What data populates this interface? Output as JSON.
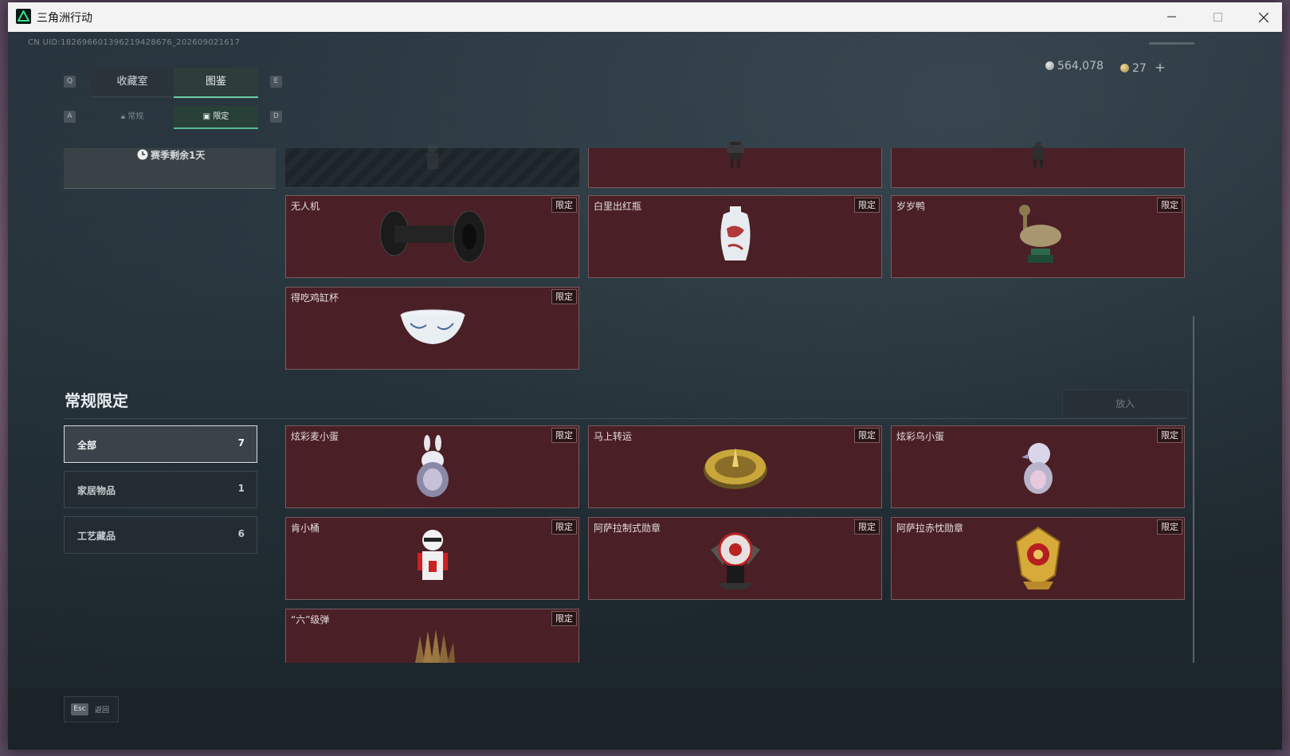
{
  "window": {
    "title": "三角洲行动"
  },
  "uid": "CN UID:182696601396219428676_202609021617",
  "currency": {
    "silver": "564,078",
    "gold": "27",
    "add": "+"
  },
  "tabs": {
    "key_left": "Q",
    "key_right": "E",
    "main": [
      {
        "label": "收藏室"
      },
      {
        "label": "图鉴"
      }
    ],
    "sub_key_left": "A",
    "sub_key_right": "D",
    "sub": [
      {
        "label": "常规"
      },
      {
        "label": "限定"
      }
    ]
  },
  "season": {
    "label": "赛季剩余1天"
  },
  "upper_cards": [
    {
      "name": "无人机",
      "badge": "限定"
    },
    {
      "name": "白里出红瓶",
      "badge": "限定"
    },
    {
      "name": "岁岁鸭",
      "badge": "限定"
    },
    {
      "name": "得吃鸡缸杯",
      "badge": "限定"
    }
  ],
  "section": {
    "title": "常规限定",
    "put_in": "放入"
  },
  "filters": [
    {
      "label": "全部",
      "count": "7"
    },
    {
      "label": "家居物品",
      "count": "1"
    },
    {
      "label": "工艺藏品",
      "count": "6"
    }
  ],
  "lower_cards": [
    {
      "name": "炫彩麦小蛋",
      "badge": "限定"
    },
    {
      "name": "马上转运",
      "badge": "限定"
    },
    {
      "name": "炫彩乌小蛋",
      "badge": "限定"
    },
    {
      "name": "肯小桶",
      "badge": "限定"
    },
    {
      "name": "阿萨拉制式勋章",
      "badge": "限定"
    },
    {
      "name": "阿萨拉赤忱勋章",
      "badge": "限定"
    },
    {
      "name": "“六”级弹",
      "badge": "限定"
    }
  ],
  "footer": {
    "key": "Esc",
    "label": "返回"
  },
  "colors": {
    "accent": "#6bd1a4",
    "card_bg": "#4a1f25",
    "card_border": "#7a5a5e"
  }
}
